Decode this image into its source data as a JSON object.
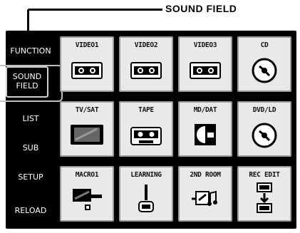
{
  "callout": {
    "label": "SOUND FIELD"
  },
  "sidebar": {
    "items": [
      {
        "label": "FUNCTION"
      },
      {
        "label": "SOUND\nFIELD",
        "selected": true
      },
      {
        "label": "LIST"
      },
      {
        "label": "SUB"
      },
      {
        "label": "SETUP"
      },
      {
        "label": "RELOAD"
      }
    ]
  },
  "tiles": [
    {
      "label": "VIDEO1",
      "icon": "cassette-icon"
    },
    {
      "label": "VIDEO2",
      "icon": "cassette-icon"
    },
    {
      "label": "VIDEO3",
      "icon": "cassette-icon"
    },
    {
      "label": "CD",
      "icon": "disc-icon"
    },
    {
      "label": "TV/SAT",
      "icon": "tv-icon"
    },
    {
      "label": "TAPE",
      "icon": "cassette-icon"
    },
    {
      "label": "MD/DAT",
      "icon": "minidisc-icon"
    },
    {
      "label": "DVD/LD",
      "icon": "disc-icon"
    },
    {
      "label": "MACRO1",
      "icon": "macro-icon"
    },
    {
      "label": "LEARNING",
      "icon": "joystick-icon"
    },
    {
      "label": "2ND ROOM",
      "icon": "room-icon"
    },
    {
      "label": "REC EDIT",
      "icon": "rec-edit-icon"
    }
  ]
}
